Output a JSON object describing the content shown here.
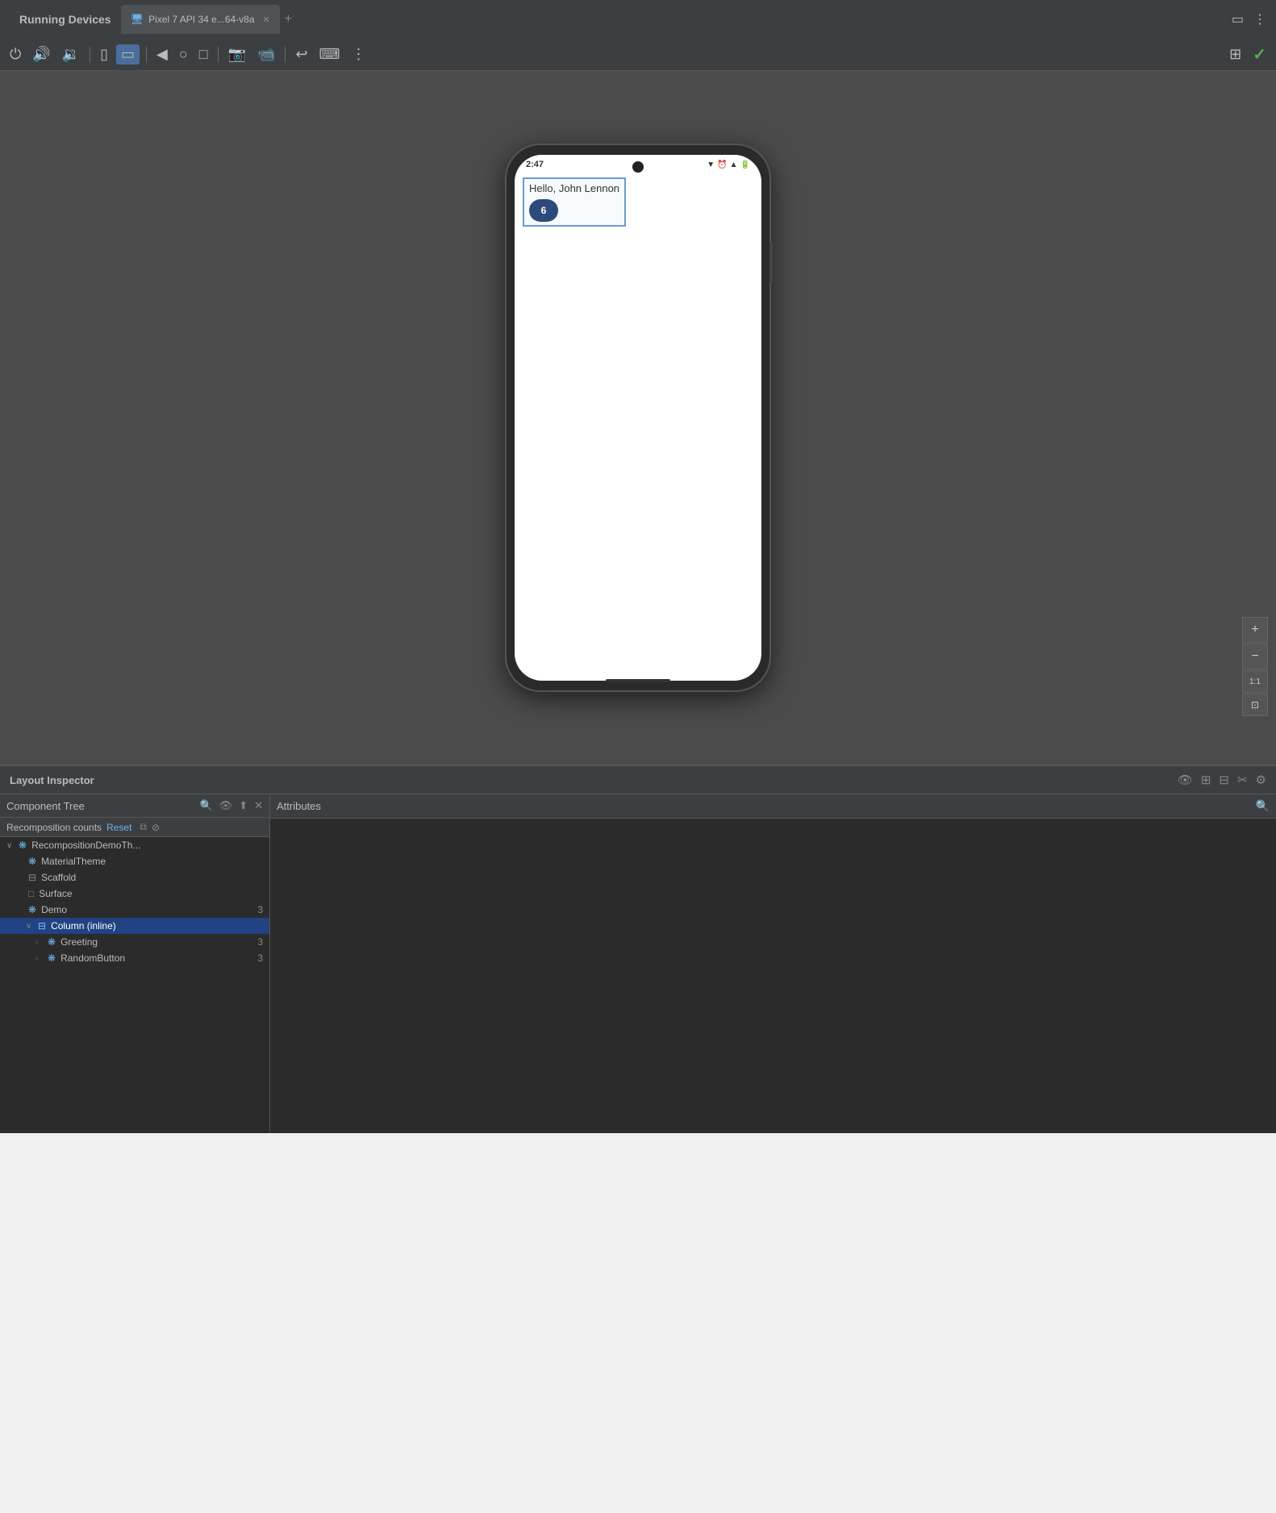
{
  "topbar": {
    "title": "Running Devices",
    "tab_label": "Pixel 7 API 34 e...64-v8a",
    "tab_icon": "📱",
    "add_tab": "+",
    "window_icon_expand": "▭",
    "window_icon_more": "⋮"
  },
  "toolbar": {
    "icons": [
      "⏻",
      "🔊",
      "🔉",
      "📱",
      "📱2",
      "◀",
      "○",
      "□",
      "📷",
      "📹",
      "↩",
      "⌨",
      "⋮"
    ],
    "right_icons": [
      "⊞",
      "✓"
    ]
  },
  "phone": {
    "time": "2:47",
    "icons_left": "⇓ ⏱",
    "greeting": "Hello, John Lennon",
    "button_label": "6",
    "home_bar": true
  },
  "zoom_controls": {
    "plus": "+",
    "minus": "−",
    "label": "1:1",
    "fit_icon": "⊡"
  },
  "layout_inspector": {
    "title": "Layout Inspector",
    "icons": [
      "👁",
      "⊞",
      "⊟",
      "✂",
      "⚙"
    ]
  },
  "component_tree": {
    "title": "Component Tree",
    "icons": [
      "🔍",
      "👁",
      "⬆",
      "✕"
    ],
    "recomposition_label": "Recomposition counts",
    "reset_label": "Reset",
    "items": [
      {
        "id": "root",
        "label": "RecompositionDemoTh...",
        "indent": 0,
        "expand": "∨",
        "icon": "compose",
        "count": ""
      },
      {
        "id": "material",
        "label": "MaterialTheme",
        "indent": 1,
        "expand": "",
        "icon": "compose",
        "count": ""
      },
      {
        "id": "scaffold",
        "label": "Scaffold",
        "indent": 1,
        "expand": "",
        "icon": "layout",
        "count": ""
      },
      {
        "id": "surface",
        "label": "Surface",
        "indent": 1,
        "expand": "",
        "icon": "outline",
        "count": ""
      },
      {
        "id": "demo",
        "label": "Demo",
        "indent": 1,
        "expand": "",
        "icon": "compose",
        "count": "3"
      },
      {
        "id": "column",
        "label": "Column (inline)",
        "indent": 2,
        "expand": "∨",
        "icon": "layout",
        "count": "",
        "selected": true
      },
      {
        "id": "greeting",
        "label": "Greeting",
        "indent": 3,
        "expand": ">",
        "icon": "compose",
        "count": "3"
      },
      {
        "id": "randombtn",
        "label": "RandomButton",
        "indent": 3,
        "expand": ">",
        "icon": "compose",
        "count": "3"
      }
    ]
  },
  "attributes": {
    "title": "Attributes",
    "search_icon": "🔍"
  }
}
